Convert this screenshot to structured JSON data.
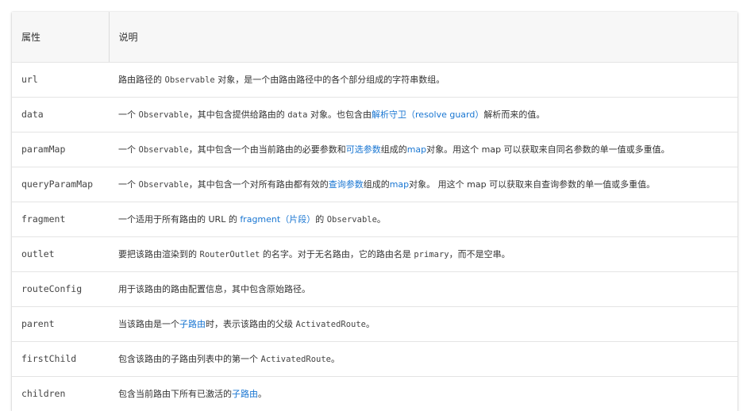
{
  "colors": {
    "link": "#1976d2",
    "header_bg": "#f7f7f7",
    "border": "#e4e4e4"
  },
  "header": {
    "col_property": "属性",
    "col_description": "说明"
  },
  "rows": [
    {
      "prop": "url",
      "parts": [
        [
          "t",
          "路由路径的 "
        ],
        [
          "c",
          "Observable"
        ],
        [
          "t",
          " 对象，是一个由路由路径中的各个部分组成的字符串数组。"
        ]
      ]
    },
    {
      "prop": "data",
      "parts": [
        [
          "t",
          "一个 "
        ],
        [
          "c",
          "Observable"
        ],
        [
          "t",
          "，其中包含提供给路由的 "
        ],
        [
          "c",
          "data"
        ],
        [
          "t",
          " 对象。也包含由"
        ],
        [
          "l",
          "解析守卫（resolve guard）"
        ],
        [
          "t",
          "解析而来的值。"
        ]
      ]
    },
    {
      "prop": "paramMap",
      "parts": [
        [
          "t",
          "一个 "
        ],
        [
          "c",
          "Observable"
        ],
        [
          "t",
          "，其中包含一个由当前路由的必要参数和"
        ],
        [
          "l",
          "可选参数"
        ],
        [
          "t",
          "组成的"
        ],
        [
          "l",
          "map"
        ],
        [
          "t",
          "对象。用这个 map 可以获取来自同名参数的单一值或多重值。"
        ]
      ]
    },
    {
      "prop": "queryParamMap",
      "parts": [
        [
          "t",
          "一个 "
        ],
        [
          "c",
          "Observable"
        ],
        [
          "t",
          "，其中包含一个对所有路由都有效的"
        ],
        [
          "l",
          "查询参数"
        ],
        [
          "t",
          "组成的"
        ],
        [
          "l",
          "map"
        ],
        [
          "t",
          "对象。 用这个 map 可以获取来自查询参数的单一值或多重值。"
        ]
      ]
    },
    {
      "prop": "fragment",
      "parts": [
        [
          "t",
          "一个适用于所有路由的 URL 的 "
        ],
        [
          "l",
          "fragment（片段）"
        ],
        [
          "t",
          "的 "
        ],
        [
          "c",
          "Observable"
        ],
        [
          "t",
          "。"
        ]
      ]
    },
    {
      "prop": "outlet",
      "parts": [
        [
          "t",
          "要把该路由渲染到的 "
        ],
        [
          "c",
          "RouterOutlet"
        ],
        [
          "t",
          " 的名字。对于无名路由，它的路由名是 "
        ],
        [
          "c",
          "primary"
        ],
        [
          "t",
          "，而不是空串。"
        ]
      ]
    },
    {
      "prop": "routeConfig",
      "parts": [
        [
          "t",
          "用于该路由的路由配置信息，其中包含原始路径。"
        ]
      ]
    },
    {
      "prop": "parent",
      "parts": [
        [
          "t",
          "当该路由是一个"
        ],
        [
          "l",
          "子路由"
        ],
        [
          "t",
          "时，表示该路由的父级 "
        ],
        [
          "c",
          "ActivatedRoute"
        ],
        [
          "t",
          "。"
        ]
      ]
    },
    {
      "prop": "firstChild",
      "parts": [
        [
          "t",
          "包含该路由的子路由列表中的第一个 "
        ],
        [
          "c",
          "ActivatedRoute"
        ],
        [
          "t",
          "。"
        ]
      ]
    },
    {
      "prop": "children",
      "parts": [
        [
          "t",
          "包含当前路由下所有已激活的"
        ],
        [
          "l",
          "子路由"
        ],
        [
          "t",
          "。"
        ]
      ]
    }
  ]
}
